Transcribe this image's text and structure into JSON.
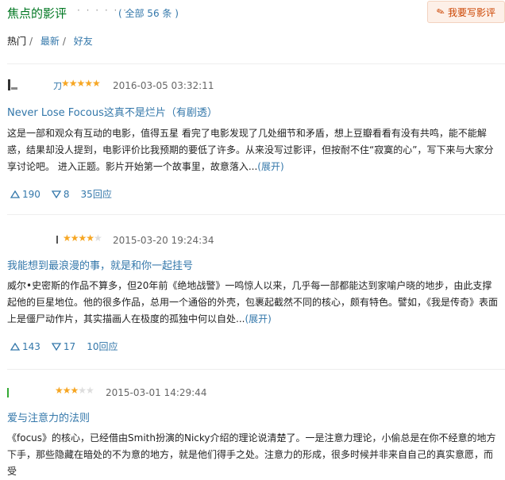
{
  "header": {
    "title": "焦点的影评",
    "dots": "· · · · · ·",
    "count": "( 全部 56 条 )",
    "write_label": "我要写影评"
  },
  "filters": [
    {
      "label": "热门",
      "sep": "/"
    },
    {
      "label": "最新",
      "sep": "/"
    },
    {
      "label": "好友",
      "sep": ""
    }
  ],
  "reviews": [
    {
      "author": "刀",
      "rating": 5,
      "time": "2016-03-05 03:32:11",
      "title": "Never Lose Focous这真不是烂片（有剧透）",
      "body": "这是一部和观众有互动的电影，值得五星 看完了电影发现了几处细节和矛盾，想上豆瓣看看有没有共鸣，能不能解惑，结果却没人提到，电影评价比我预期的要低了许多。从来没写过影评，但按耐不住“寂寞的心”，写下来与大家分享讨论吧。 进入正题。影片开始第一个故事里，故意落入...",
      "more": "(展开)",
      "up": "190",
      "down": "8",
      "replies": "35回应"
    },
    {
      "author": "",
      "rating": 4,
      "time": "2015-03-20 19:24:34",
      "title": "我能想到最浪漫的事，就是和你一起挂号",
      "body": "威尔•史密斯的作品不算多，但20年前《绝地战警》一鸣惊人以来，几乎每一部都能达到家喻户晓的地步，由此支撑起他的巨星地位。他的很多作品，总用一个通俗的外壳，包裹起截然不同的核心，颇有特色。譬如，《我是传奇》表面上是僵尸动作片，其实描画人在极度的孤独中何以自处...",
      "more": "(展开)",
      "up": "143",
      "down": "17",
      "replies": "10回应"
    },
    {
      "author": "",
      "rating": 3,
      "time": "2015-03-01 14:29:44",
      "title": "爱与注意力的法则",
      "body": "《focus》的核心，已经借由Smith扮演的Nicky介绍的理论说清楚了。一是注意力理论，小偷总是在你不经意的地方下手，那些隐藏在暗处的不为意的地方，就是他们得手之处。注意力的形成，很多时候并非来自自己的真实意愿，而受",
      "more": "",
      "up": "",
      "down": "",
      "replies": ""
    }
  ],
  "colors": {
    "green": "#007722",
    "link": "#3377aa",
    "star": "#f6a623"
  }
}
